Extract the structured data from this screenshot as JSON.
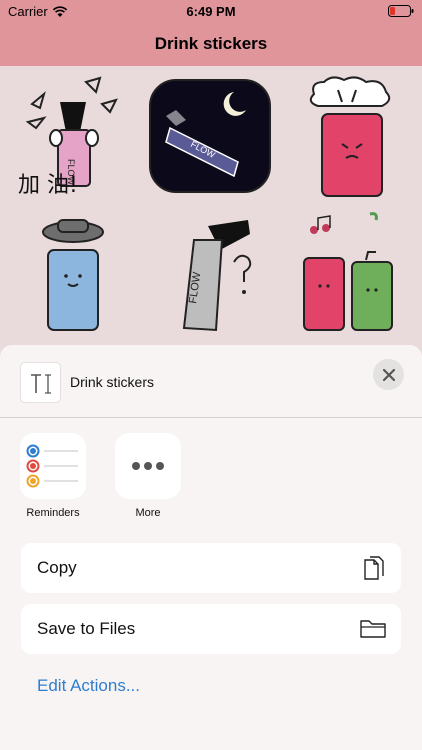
{
  "status_bar": {
    "carrier": "Carrier",
    "time": "6:49 PM"
  },
  "navbar": {
    "title": "Drink stickers"
  },
  "stickers": {
    "sticker1_caption": "加  油!",
    "sticker1_cup_text": "FLOW",
    "sticker2_cup_text": "FLOW",
    "sticker5_cup_text": "FLOW"
  },
  "share_sheet": {
    "file_name": "Drink stickers",
    "apps": [
      {
        "label": "Reminders",
        "icon": "reminders-icon"
      },
      {
        "label": "More",
        "icon": "more-icon"
      }
    ],
    "actions": [
      {
        "label": "Copy",
        "icon": "copy-icon"
      },
      {
        "label": "Save to Files",
        "icon": "folder-icon"
      }
    ],
    "edit_actions_label": "Edit Actions...",
    "accent_color": "#2f7dd1",
    "reminder_colors": [
      "#2f7dd1",
      "#e04b3f",
      "#f0a42a"
    ]
  },
  "colors": {
    "nav_bar": "#e0959b",
    "background": "#e9dadc",
    "sheet": "#f7f4f3"
  }
}
